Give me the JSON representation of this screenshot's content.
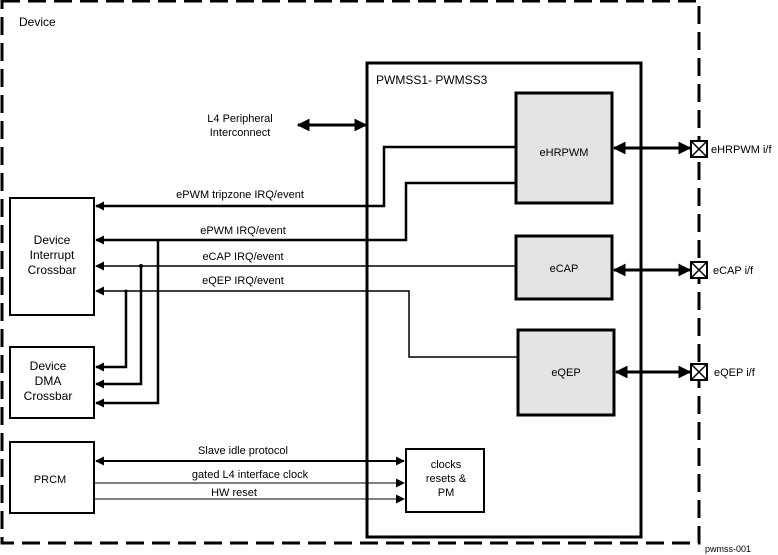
{
  "device": {
    "title": "Device"
  },
  "subsystem": {
    "title": "PWMSS1- PWMSS3"
  },
  "interconnect": {
    "line1": "L4 Peripheral",
    "line2": "Interconnect"
  },
  "modules": {
    "ehrpwm": "eHRPWM",
    "ecap": "eCAP",
    "eqep": "eQEP",
    "clocks": {
      "line1": "clocks",
      "line2": "resets &",
      "line3": "PM"
    }
  },
  "external_blocks": {
    "interrupt_crossbar": {
      "line1": "Device",
      "line2": "Interrupt",
      "line3": "Crossbar"
    },
    "dma_crossbar": {
      "line1": "Device",
      "line2": "DMA",
      "line3": "Crossbar"
    },
    "prcm": "PRCM"
  },
  "signals": {
    "epwm_tripzone": "ePWM tripzone IRQ/event",
    "epwm_irq": "ePWM IRQ/event",
    "ecap_irq": "eCAP IRQ/event",
    "eqep_irq": "eQEP IRQ/event",
    "slave_idle": "Slave idle protocol",
    "gated_clock": "gated L4 interface clock",
    "hw_reset": "HW reset"
  },
  "interfaces": {
    "ehrpwm_if": "eHRPWM  i/f",
    "ecap_if": "eCAP i/f",
    "eqep_if": "eQEP i/f"
  },
  "figure_id": "pwmss-001",
  "colors": {
    "module_fill": "#e4e4e4",
    "line": "#000000"
  }
}
